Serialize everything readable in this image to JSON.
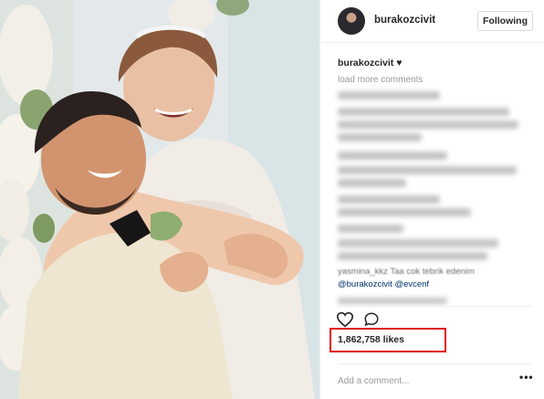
{
  "post": {
    "photo_alt": "wedding couple photo",
    "header": {
      "username": "burakozcivit",
      "follow_label": "Following"
    },
    "caption": {
      "username": "burakozcivit",
      "text": "♥"
    },
    "load_more_label": "load more comments",
    "comments_visible": [
      {
        "text": "yasmina_kkz Taa cok tebrik edenim",
        "mention": ""
      },
      {
        "text": "",
        "mention": "@burakozcivit @evcenf"
      }
    ],
    "likes_text": "1,862,758 likes",
    "add_comment_placeholder": "Add a comment...",
    "more_label": "•••"
  },
  "icons": [
    "heart-icon",
    "comment-icon",
    "more-options-icon"
  ],
  "colors": {
    "highlight_box": "#e0161b",
    "mention_link": "#003569",
    "muted_text": "#999999"
  }
}
